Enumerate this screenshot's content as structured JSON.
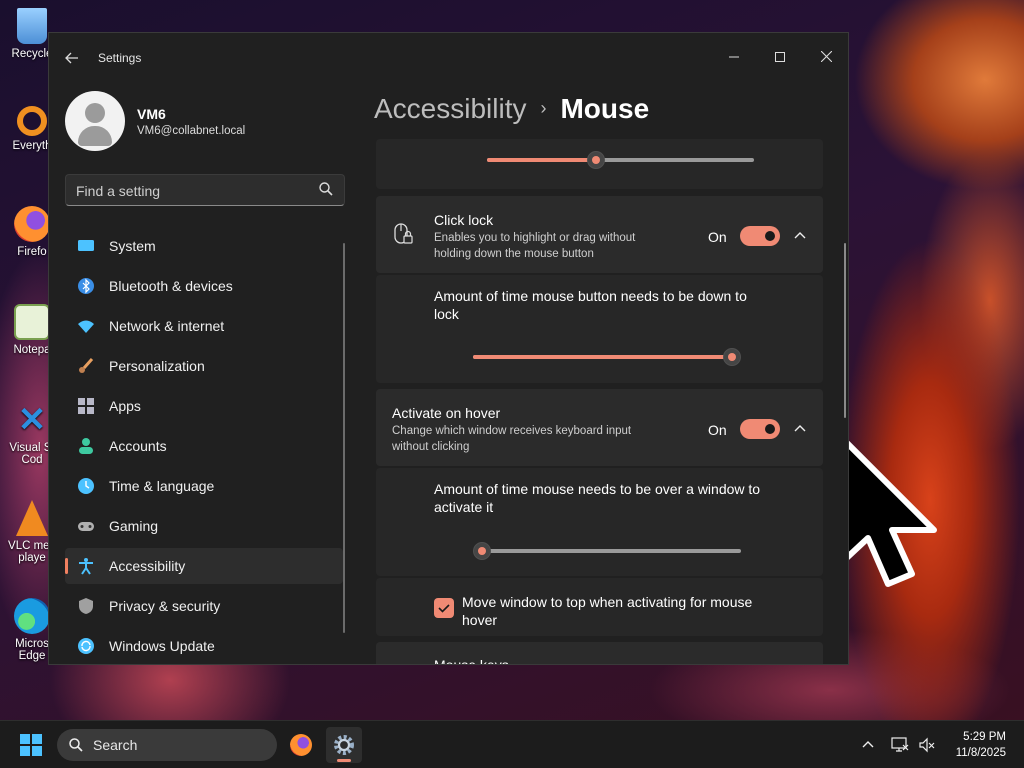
{
  "desktop": {
    "icons": [
      {
        "label": "Recycle",
        "icon": "recycle-bin-icon"
      },
      {
        "label": "Everyth",
        "icon": "everything-search-icon"
      },
      {
        "label": "Firefo",
        "icon": "firefox-icon"
      },
      {
        "label": "Notepa",
        "icon": "notepad-icon"
      },
      {
        "label": "Visual St Cod",
        "icon": "vscode-icon"
      },
      {
        "label": "VLC med playe",
        "icon": "vlc-icon"
      },
      {
        "label": "Micros Edge",
        "icon": "edge-icon"
      }
    ]
  },
  "window": {
    "title": "Settings",
    "controls": [
      "minimize",
      "maximize",
      "close"
    ]
  },
  "user": {
    "name": "VM6",
    "email": "VM6@collabnet.local"
  },
  "search": {
    "placeholder": "Find a setting"
  },
  "nav": {
    "items": [
      {
        "label": "System",
        "icon": "system-icon",
        "color": "#4cc2ff"
      },
      {
        "label": "Bluetooth & devices",
        "icon": "bluetooth-icon",
        "color": "#3a8ee6"
      },
      {
        "label": "Network & internet",
        "icon": "wifi-icon",
        "color": "#4cc2ff"
      },
      {
        "label": "Personalization",
        "icon": "brush-icon",
        "color": "#e8a060"
      },
      {
        "label": "Apps",
        "icon": "apps-icon",
        "color": "#b8b8c8"
      },
      {
        "label": "Accounts",
        "icon": "accounts-icon",
        "color": "#3ec9a0"
      },
      {
        "label": "Time & language",
        "icon": "clock-globe-icon",
        "color": "#4cc2ff"
      },
      {
        "label": "Gaming",
        "icon": "gamepad-icon",
        "color": "#b0b0b0"
      },
      {
        "label": "Accessibility",
        "icon": "accessibility-icon",
        "color": "#4cc2ff"
      },
      {
        "label": "Privacy & security",
        "icon": "shield-icon",
        "color": "#a0a0a0"
      },
      {
        "label": "Windows Update",
        "icon": "windows-update-icon",
        "color": "#4cc2ff"
      }
    ],
    "active_index": 8
  },
  "breadcrumb": {
    "parent": "Accessibility",
    "separator": "›",
    "current": "Mouse"
  },
  "content": {
    "top_slider": {
      "value": 0.41
    },
    "click_lock": {
      "title": "Click lock",
      "description": "Enables you to highlight or drag without holding down the mouse button",
      "state": "On",
      "expanded": true,
      "sub_label": "Amount of time mouse button needs to be down to lock",
      "slider_value": 1.0
    },
    "activate_on_hover": {
      "title": "Activate on hover",
      "description": "Change which window receives keyboard input without clicking",
      "state": "On",
      "expanded": true,
      "sub_label": "Amount of time mouse needs to be over a window to activate it",
      "slider_value": 0.0,
      "checkbox_label": "Move window to top when activating for mouse hover",
      "checkbox_checked": true
    },
    "next_section_partial": "Mouse keys"
  },
  "taskbar": {
    "search_label": "Search",
    "time": "5:29 PM",
    "date": "11/8/2025",
    "accent": "#f08a74"
  },
  "theme": {
    "accent": "#f08a74",
    "window_bg": "#202020",
    "card_bg": "#2b2b2b"
  }
}
